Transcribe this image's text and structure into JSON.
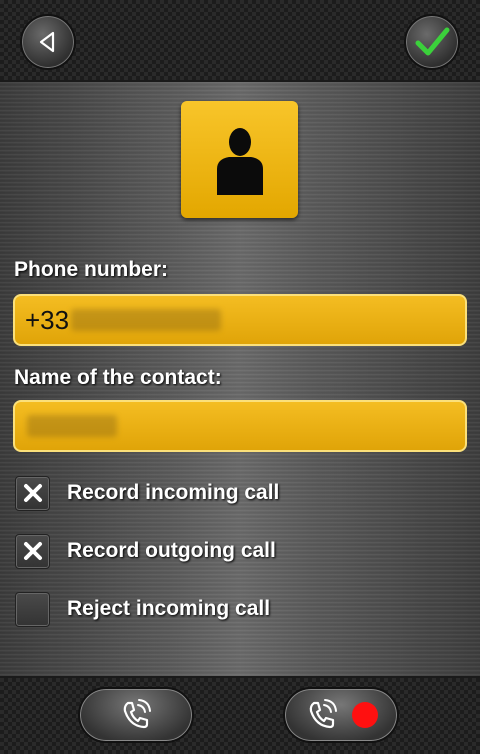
{
  "header": {
    "back_icon": "back-triangle-icon",
    "confirm_icon": "checkmark-icon",
    "confirm_color": "#3bd13b"
  },
  "contact": {
    "avatar_icon": "person-silhouette-icon",
    "phone_label": "Phone number:",
    "phone_value": "+33",
    "name_label": "Name of the contact:",
    "name_value": ""
  },
  "options": [
    {
      "label": "Record incoming call",
      "checked": true
    },
    {
      "label": "Record outgoing call",
      "checked": true
    },
    {
      "label": "Reject incoming call",
      "checked": false
    }
  ],
  "footer": {
    "call_button_icon": "phone-ringing-icon",
    "record_button_icon": "phone-ringing-icon",
    "record_indicator_color": "#ff1010"
  },
  "colors": {
    "accent": "#f0b51a",
    "background": "#4a4a4a"
  }
}
